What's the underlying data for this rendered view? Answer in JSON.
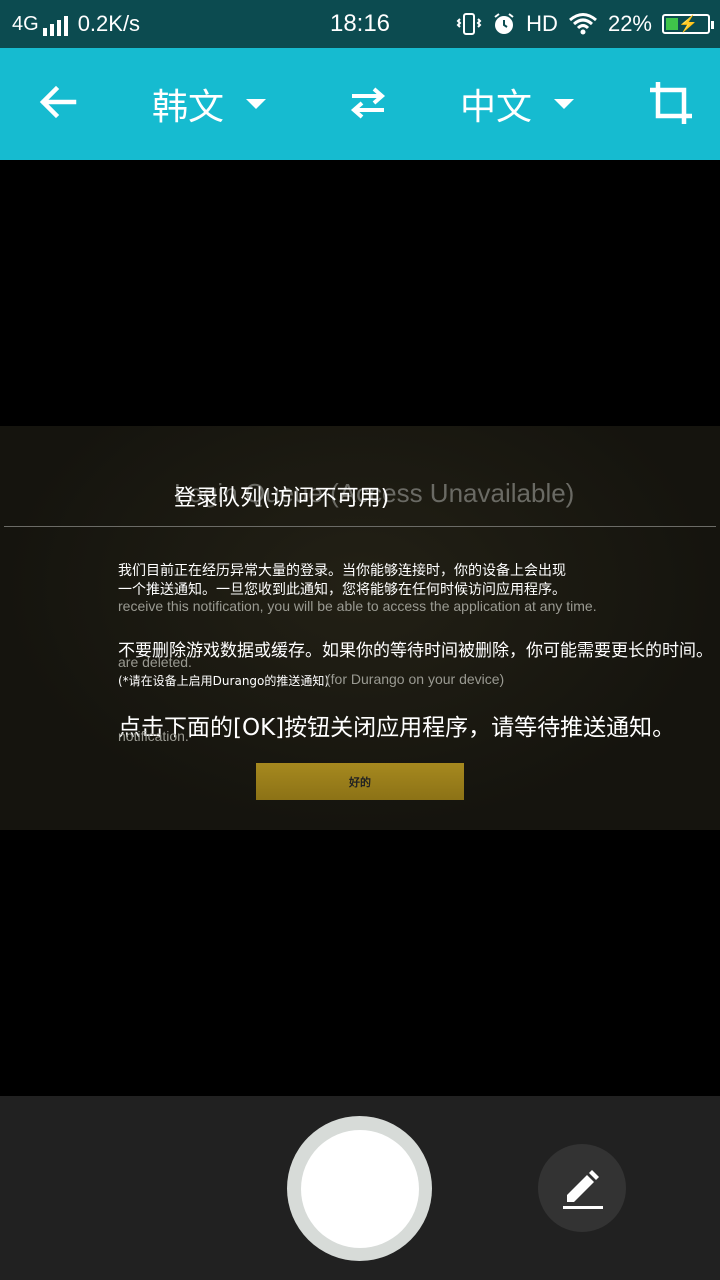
{
  "status_bar": {
    "network": "4G",
    "speed": "0.2K/s",
    "time": "18:16",
    "hd": "HD",
    "battery": "22%"
  },
  "toolbar": {
    "back_icon": "arrow-left-icon",
    "source_language": "韩文",
    "swap_icon": "swap-arrows-icon",
    "target_language": "中文",
    "crop_icon": "crop-icon"
  },
  "dialog": {
    "title_en": "Login Queue (Access Unavailable)",
    "title_zh": "登录队列(访问不可用)",
    "lines": [
      {
        "zh": "我们目前正在经历异常大量的登录。当你能够连接时，你的设备上会出现"
      },
      {
        "zh": "一个推送通知。一旦您收到此通知，您将能够在任何时候访问应用程序。"
      },
      {
        "en": "receive this notification, you will be able to access the application at any time."
      },
      {
        "zh": "不要删除游戏数据或缓存。如果你的等待时间被删除，你可能需要更长的时间。"
      },
      {
        "en": "are deleted."
      },
      {
        "zh": "(*请在设备上启用Durango的推送通知)"
      },
      {
        "en": "(for Durango on your device)"
      },
      {
        "zh": "点击下面的[OK]按钮关闭应用程序，请等待推送通知。"
      },
      {
        "en": "notification."
      }
    ],
    "ok_label": "好的"
  },
  "bottom": {
    "shutter_label": "shutter-button",
    "edit_icon": "pencil-icon"
  },
  "colors": {
    "status_bar": "#0c4b50",
    "toolbar": "#16bbd0",
    "bottom_bar": "#212121",
    "ok_button": "#a6891f"
  }
}
